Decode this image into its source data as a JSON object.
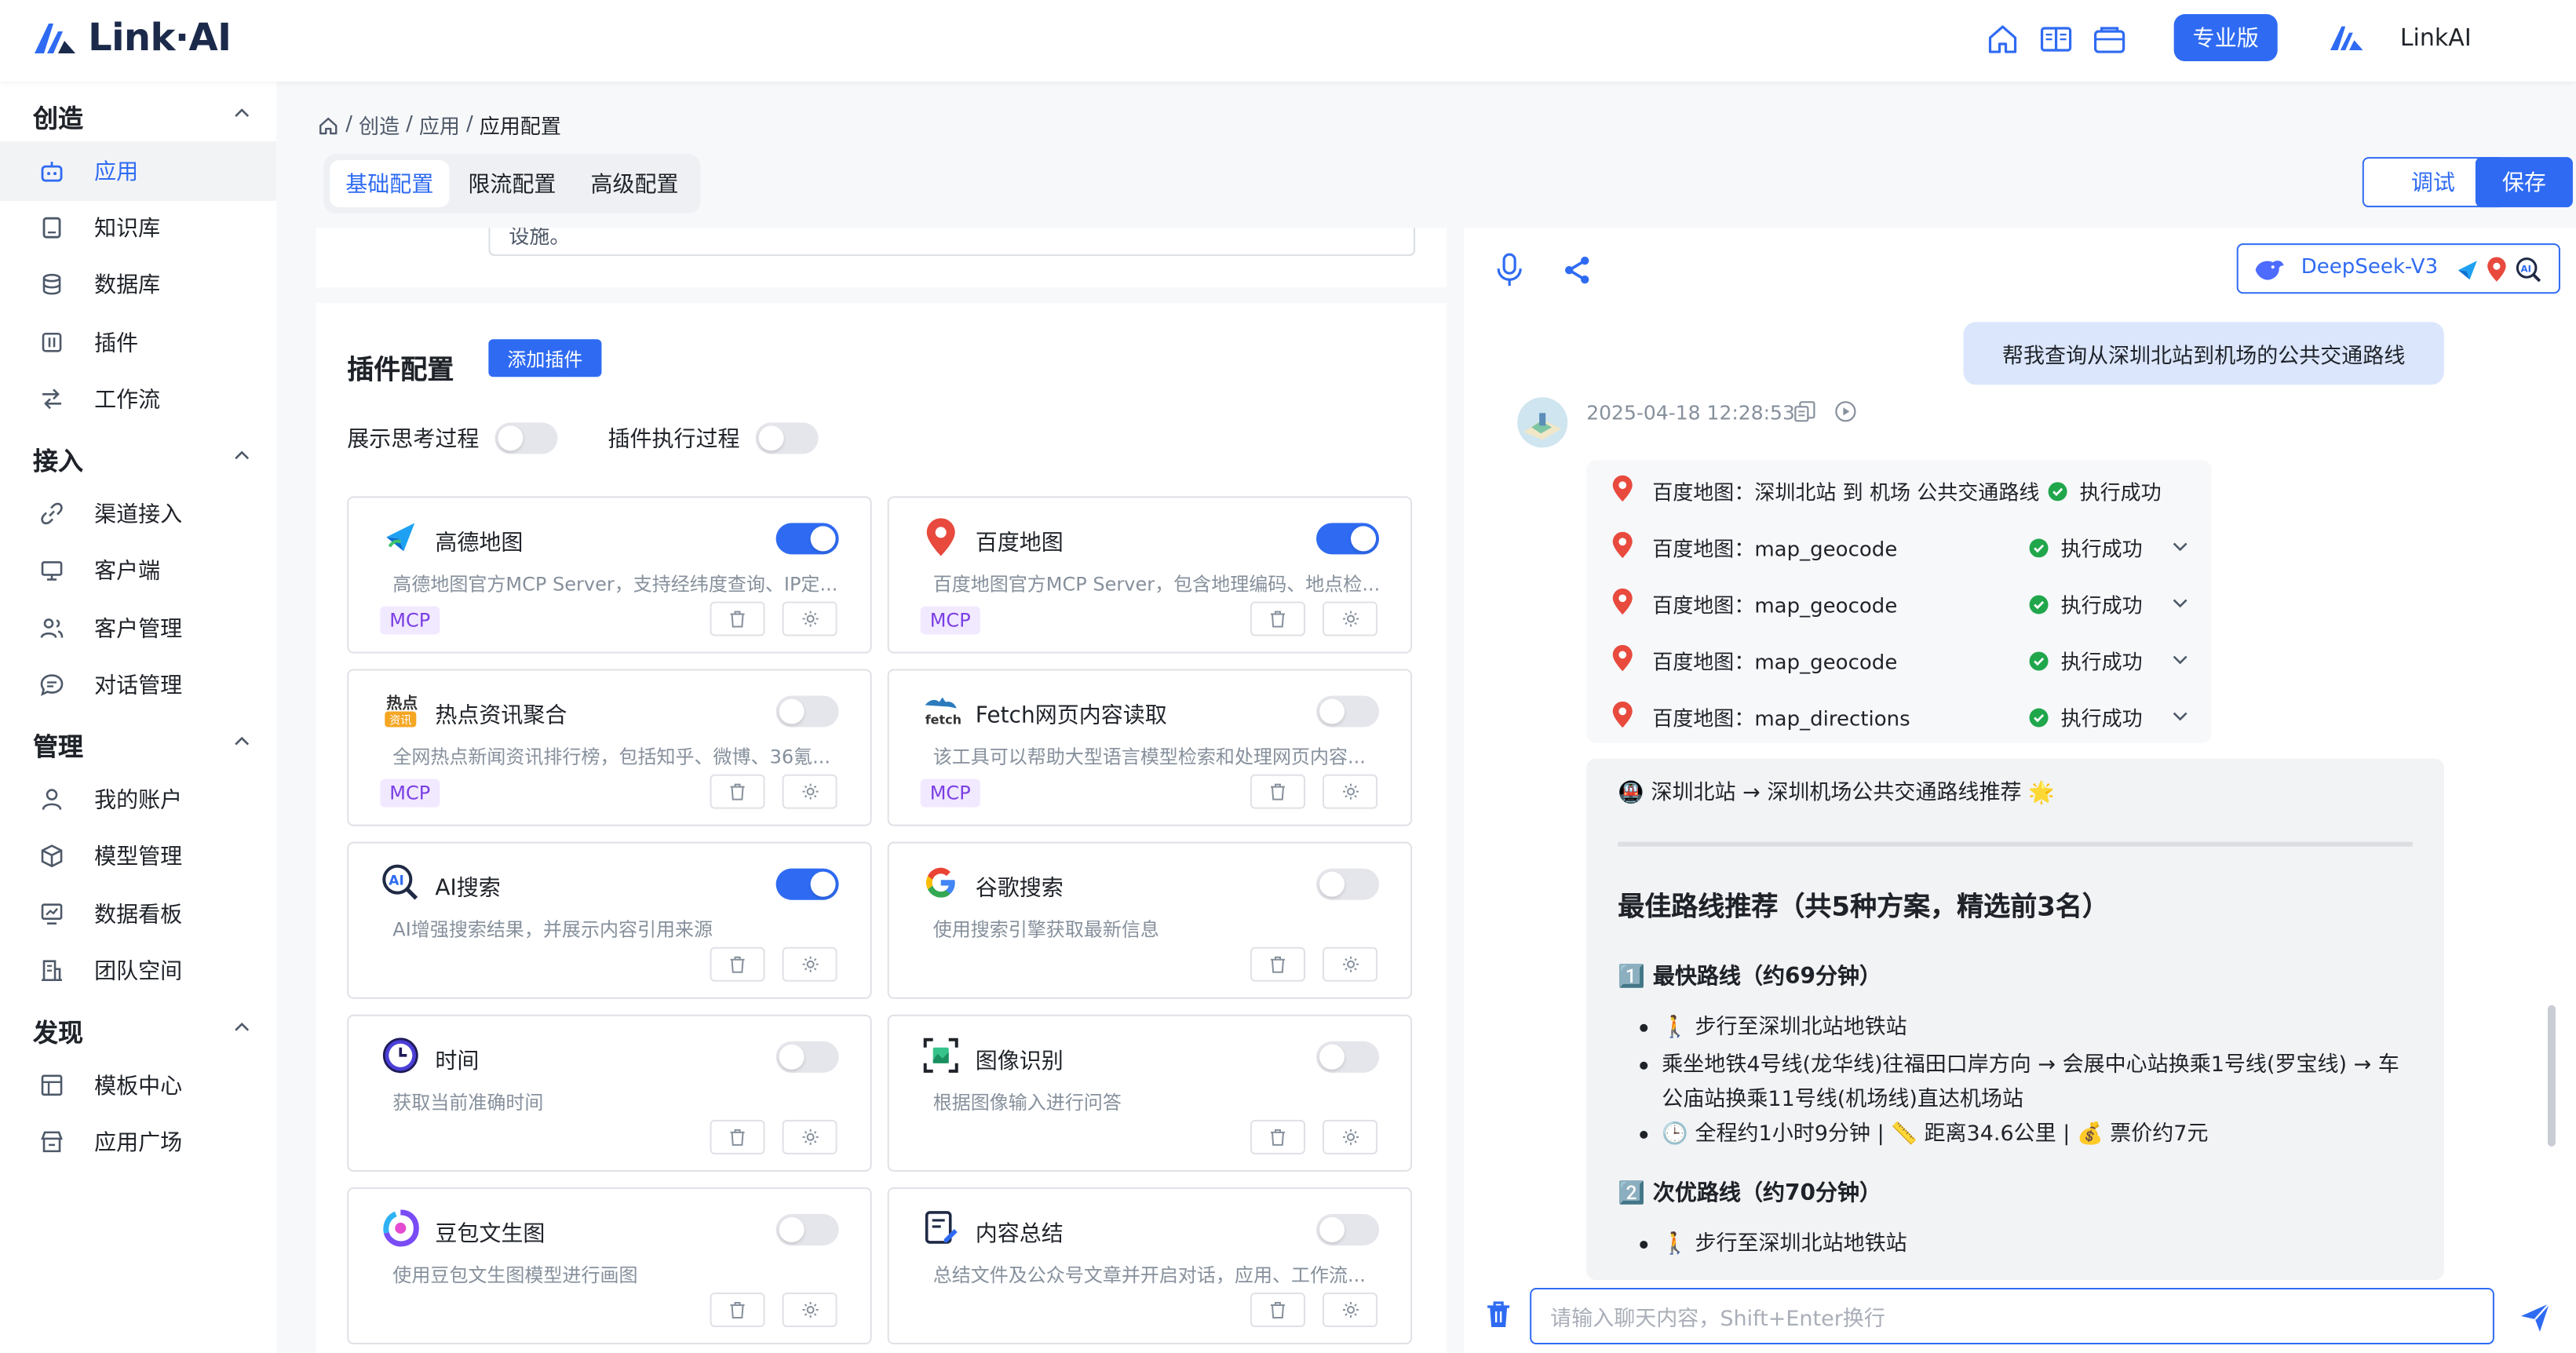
{
  "header": {
    "logo_text": "Link·AI",
    "pro_label": "专业版",
    "user_name": "LinkAI",
    "icons": [
      "home-icon",
      "book-icon",
      "wallet-icon"
    ]
  },
  "sidebar": {
    "sections": [
      {
        "title": "创造",
        "items": [
          "应用",
          "知识库",
          "数据库",
          "插件",
          "工作流"
        ]
      },
      {
        "title": "接入",
        "items": [
          "渠道接入",
          "客户端",
          "客户管理",
          "对话管理"
        ]
      },
      {
        "title": "管理",
        "items": [
          "我的账户",
          "模型管理",
          "数据看板",
          "团队空间"
        ]
      },
      {
        "title": "发现",
        "items": [
          "模板中心",
          "应用广场"
        ]
      }
    ],
    "active_item": "应用"
  },
  "breadcrumb": {
    "a": "创造",
    "b": "应用",
    "c": "应用配置",
    "sep": "/"
  },
  "tabs": [
    "基础配置",
    "限流配置",
    "高级配置"
  ],
  "actions": {
    "debug": "调试",
    "save": "保存"
  },
  "prev_card_text": "设施。",
  "plugins": {
    "title": "插件配置",
    "add_label": "添加插件",
    "toggle_think": "展示思考过程",
    "toggle_exec": "插件执行过程",
    "mini_icons": [
      "trash-icon",
      "gear-icon"
    ],
    "items": [
      {
        "name": "高德地图",
        "desc": "高德地图官方MCP Server，支持经纬度查询、IP定...",
        "tag": "MCP",
        "enabled": true
      },
      {
        "name": "百度地图",
        "desc": "百度地图官方MCP Server，包含地理编码、地点检...",
        "tag": "MCP",
        "enabled": true
      },
      {
        "name": "热点资讯聚合",
        "desc": "全网热点新闻资讯排行榜，包括知乎、微博、36氪...",
        "tag": "MCP",
        "enabled": false
      },
      {
        "name": "Fetch网页内容读取",
        "desc": "该工具可以帮助大型语言模型检索和处理网页内容...",
        "tag": "MCP",
        "enabled": false
      },
      {
        "name": "AI搜索",
        "desc": "AI增强搜索结果，并展示内容引用来源",
        "tag": "",
        "enabled": true
      },
      {
        "name": "谷歌搜索",
        "desc": "使用搜索引擎获取最新信息",
        "tag": "",
        "enabled": false
      },
      {
        "name": "时间",
        "desc": "获取当前准确时间",
        "tag": "",
        "enabled": false
      },
      {
        "name": "图像识别",
        "desc": "根据图像输入进行问答",
        "tag": "",
        "enabled": false
      },
      {
        "name": "豆包文生图",
        "desc": "使用豆包文生图模型进行画图",
        "tag": "",
        "enabled": false
      },
      {
        "name": "内容总结",
        "desc": "总结文件及公众号文章并开启对话，应用、工作流...",
        "tag": "",
        "enabled": false
      }
    ]
  },
  "chat": {
    "model": "DeepSeek-V3",
    "user_message": "帮我查询从深圳北站到机场的公共交通路线",
    "timestamp": "2025-04-18 12:28:53",
    "tool_calls": [
      {
        "name": "百度地图：深圳北站 到 机场 公共交通路线",
        "status": "执行成功"
      },
      {
        "name": "百度地图：map_geocode",
        "status": "执行成功"
      },
      {
        "name": "百度地图：map_geocode",
        "status": "执行成功"
      },
      {
        "name": "百度地图：map_geocode",
        "status": "执行成功"
      },
      {
        "name": "百度地图：map_directions",
        "status": "执行成功"
      }
    ],
    "answer": {
      "head": "🚇 深圳北站 → 深圳机场公共交通路线推荐 🌟",
      "h1": "最佳路线推荐（共5种方案，精选前3名）",
      "route1_title": "1️⃣ 最快路线（约69分钟）",
      "route1_items": [
        "🚶 步行至深圳北站地铁站",
        "乘坐地铁4号线(龙华线)往福田口岸方向 → 会展中心站换乘1号线(罗宝线) → 车公庙站换乘11号线(机场线)直达机场站",
        "🕒 全程约1小时9分钟 | 📏 距离34.6公里 | 💰 票价约7元"
      ],
      "route2_title": "2️⃣ 次优路线（约70分钟）",
      "route2_items": [
        "🚶 步行至深圳北站地铁站"
      ]
    },
    "input_placeholder": "请输入聊天内容，Shift+Enter换行"
  }
}
